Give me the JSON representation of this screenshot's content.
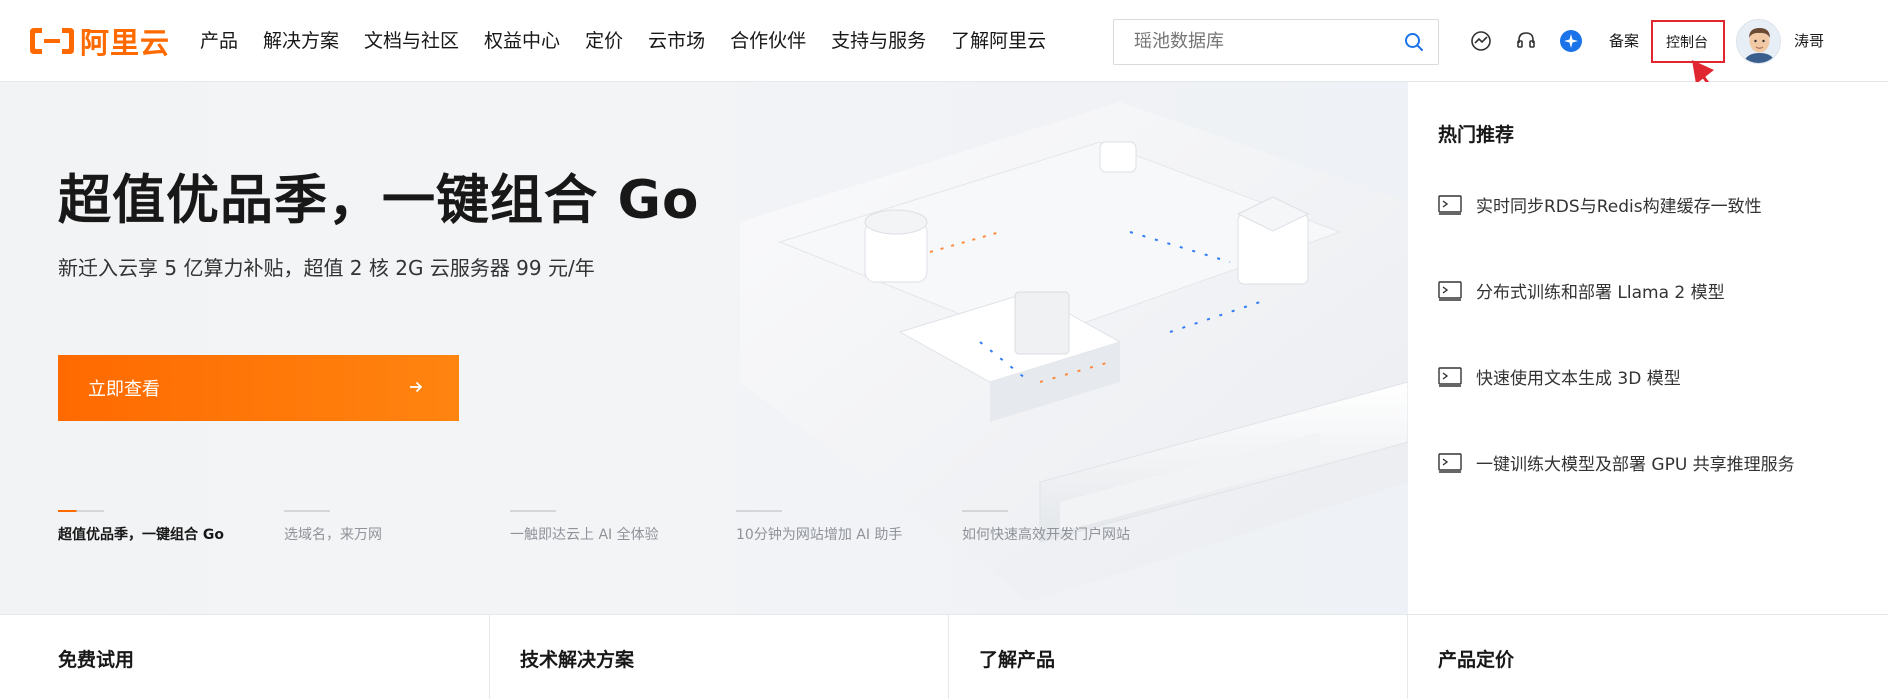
{
  "header": {
    "logo_text": "阿里云",
    "nav": [
      "产品",
      "解决方案",
      "文档与社区",
      "权益中心",
      "定价",
      "云市场",
      "合作伙伴",
      "支持与服务",
      "了解阿里云"
    ],
    "search": {
      "placeholder": "瑶池数据库"
    },
    "icons": [
      "dashboard-icon",
      "support-headset-icon",
      "app-badge-icon"
    ],
    "beian_label": "备案",
    "console_label": "控制台",
    "username": "涛哥"
  },
  "hero": {
    "title": "超值优品季，一键组合 Go",
    "subtitle": "新迁入云享 5 亿算力补贴，超值 2 核 2G 云服务器 99 元/年",
    "cta_label": "立即查看",
    "slides": [
      {
        "label": "超值优品季，一键组合 Go",
        "active": true
      },
      {
        "label": "选域名，来万网",
        "active": false
      },
      {
        "label": "一触即达云上 AI 全体验",
        "active": false
      },
      {
        "label": "10分钟为网站增加 AI 助手",
        "active": false
      },
      {
        "label": "如何快速高效开发门户网站",
        "active": false
      }
    ]
  },
  "hot": {
    "title": "热门推荐",
    "items": [
      "实时同步RDS与Redis构建缓存一致性",
      "分布式训练和部署 Llama 2 模型",
      "快速使用文本生成 3D 模型",
      "一键训练大模型及部署 GPU 共享推理服务"
    ]
  },
  "bottom": [
    "免费试用",
    "技术解决方案",
    "了解产品",
    "产品定价"
  ],
  "colors": {
    "brand": "#ff6a00",
    "annotation": "#e0262e"
  }
}
